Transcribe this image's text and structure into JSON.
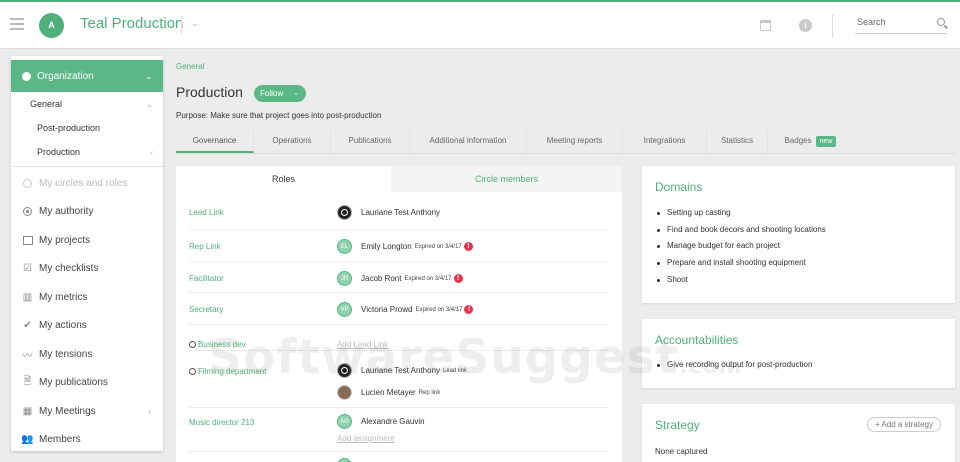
{
  "header": {
    "avatar_initial": "A",
    "title": "Teal Production",
    "search_placeholder": "Search"
  },
  "sidebar": {
    "organization": "Organization",
    "general": "General",
    "sub_items": [
      "Post-production",
      "Production"
    ],
    "items": [
      {
        "label": "My circles and roles",
        "icon": "circle-icon",
        "disabled": true
      },
      {
        "label": "My authority",
        "icon": "authority-icon"
      },
      {
        "label": "My projects",
        "icon": "projects-icon"
      },
      {
        "label": "My checklists",
        "icon": "checklist-icon"
      },
      {
        "label": "My metrics",
        "icon": "metrics-icon"
      },
      {
        "label": "My actions",
        "icon": "check-icon"
      },
      {
        "label": "My tensions",
        "icon": "tensions-icon"
      },
      {
        "label": "My publications",
        "icon": "document-icon"
      },
      {
        "label": "My Meetings",
        "icon": "calendar-icon"
      },
      {
        "label": "Members",
        "icon": "members-icon"
      }
    ]
  },
  "main": {
    "breadcrumb": "General",
    "title": "Production",
    "follow_label": "Follow",
    "purpose": "Purpose: Make sure that project goes into post-production",
    "tabs": [
      "Governance",
      "Operations",
      "Publications",
      "Additional information",
      "Meeting reports",
      "Integrations",
      "Statistics",
      "Badges"
    ],
    "tab_badge": "new",
    "active_tab": "Governance"
  },
  "roles_panel": {
    "tab_roles": "Roles",
    "tab_members": "Circle members",
    "rows": [
      {
        "role": "Lead Link",
        "member": "Lauriane Test Anthony",
        "avatar": "dark"
      },
      {
        "role": "Rep Link",
        "member": "Emily Longton",
        "initials": "EL",
        "expired": "Expired on 3/4/17"
      },
      {
        "role": "Facilitator",
        "member": "Jacob Ront",
        "initials": "JR",
        "expired": "Expired on 3/4/17"
      },
      {
        "role": "Secretary",
        "member": "Victoria Prowd",
        "initials": "VP",
        "expired": "Expired on 3/4/17"
      },
      {
        "role": "Business dev",
        "add_link": "Add Lead Link"
      },
      {
        "role": "Filming department",
        "member": "Lauriane Test Anthony",
        "sublabel": "Lead link",
        "member2": "Lucien Metayer",
        "sublabel2": "Rep link"
      },
      {
        "role": "Music director 213",
        "member": "Alexandre Gauvin",
        "initials": "AG",
        "add_link": "Add assignment"
      }
    ]
  },
  "cards": {
    "domains": {
      "title": "Domains",
      "items": [
        "Setting up casting",
        "Find and book decors and shooting locations",
        "Manage budget for each project",
        "Prepare and install shooting equipment",
        "Shoot"
      ]
    },
    "accountabilities": {
      "title": "Accountabilities",
      "items": [
        "Give recording output for post-production"
      ]
    },
    "strategy": {
      "title": "Strategy",
      "add_label": "Add a strategy",
      "empty": "None captured"
    }
  },
  "watermark": {
    "text": "SoftwareSuggest",
    "suffix": ".com"
  },
  "colors": {
    "accent": "#5bb886",
    "warning": "#e8314b"
  }
}
